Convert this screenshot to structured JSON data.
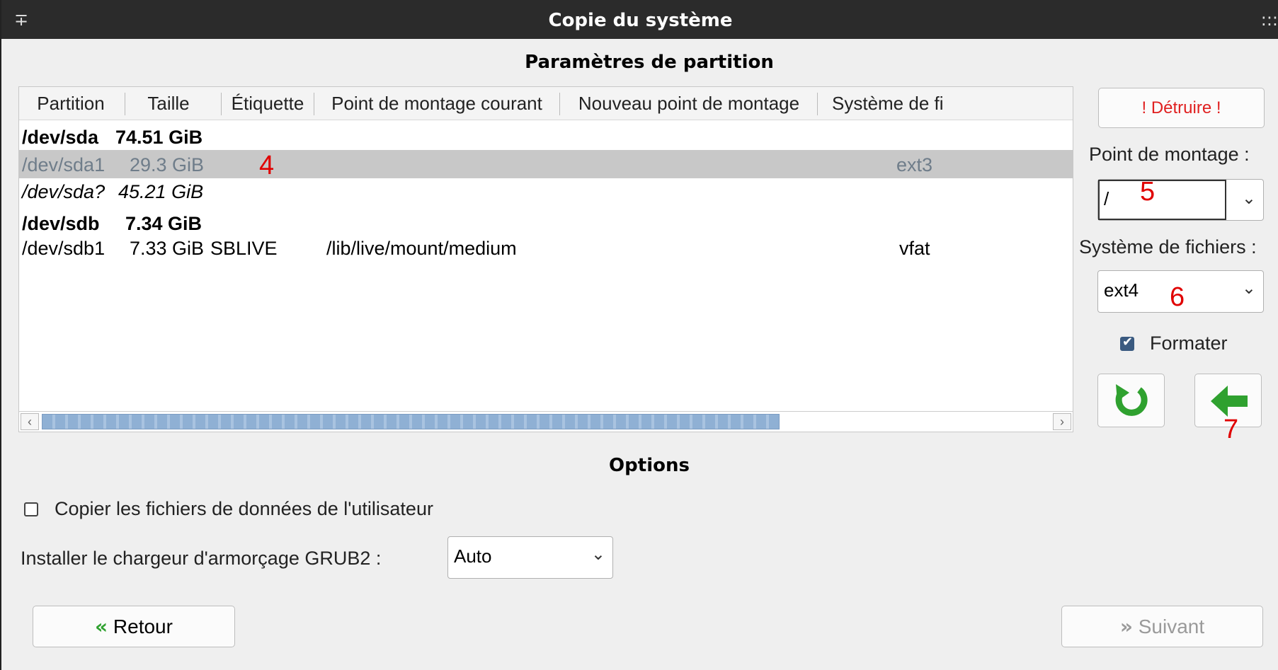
{
  "window": {
    "title": "Copie du système",
    "pin_glyph": "∓",
    "menu_glyph": ":::"
  },
  "partition_section": {
    "title": "Paramètres de partition"
  },
  "table": {
    "columns": [
      "Partition",
      "Taille",
      "Étiquette",
      "Point de montage courant",
      "Nouveau point de montage",
      "Système de fic"
    ],
    "rows": [
      {
        "partition": "/dev/sda",
        "size": "74.51 GiB",
        "label": "",
        "current_mount": "",
        "new_mount": "",
        "fs": "",
        "style": "disk"
      },
      {
        "partition": "/dev/sda1",
        "size": "29.3 GiB",
        "label": "",
        "current_mount": "",
        "new_mount": "",
        "fs": "ext3",
        "style": "selected"
      },
      {
        "partition": "/dev/sda?",
        "size": "45.21 GiB",
        "label": "",
        "current_mount": "",
        "new_mount": "",
        "fs": "",
        "style": "free"
      },
      {
        "partition": "/dev/sdb",
        "size": "7.34 GiB",
        "label": "",
        "current_mount": "",
        "new_mount": "",
        "fs": "",
        "style": "disk"
      },
      {
        "partition": "/dev/sdb1",
        "size": "7.33 GiB",
        "label": "SBLIVE",
        "current_mount": "/lib/live/mount/medium",
        "new_mount": "",
        "fs": "vfat",
        "style": "normal"
      }
    ]
  },
  "side_panel": {
    "destroy_label": "! Détruire !",
    "mount_point_label": "Point de montage :",
    "mount_point_value": "/",
    "filesystem_label": "Système de fichiers :",
    "filesystem_value": "ext4",
    "format_label": "Formater",
    "format_checked": true
  },
  "options": {
    "title": "Options",
    "copy_user_data_label": "Copier les fichiers de données de l'utilisateur",
    "copy_user_data_checked": false,
    "grub_label": "Installer le chargeur d'armorçage GRUB2 :",
    "grub_value": "Auto"
  },
  "nav": {
    "back_label": "Retour",
    "next_label": "Suivant"
  },
  "annotations": {
    "n4": "4",
    "n5": "5",
    "n6": "6",
    "n7": "7"
  },
  "colors": {
    "accent_green": "#2fa12f",
    "destroy_red": "#e02020",
    "annotation_red": "#e00000"
  }
}
